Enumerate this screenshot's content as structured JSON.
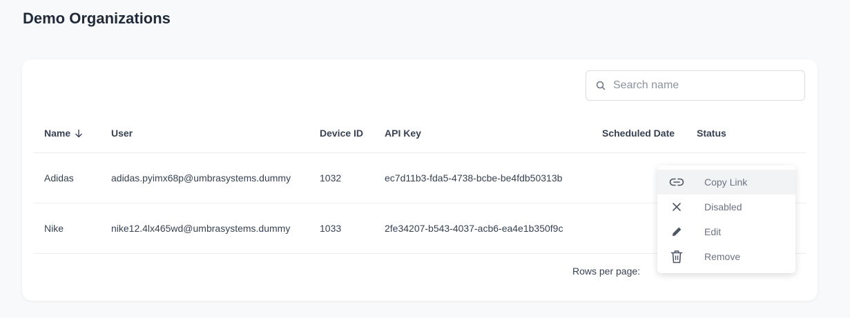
{
  "page": {
    "title": "Demo Organizations"
  },
  "search": {
    "placeholder": "Search name",
    "value": ""
  },
  "table": {
    "columns": [
      {
        "key": "name",
        "label": "Name",
        "sorted": "descending"
      },
      {
        "key": "user",
        "label": "User"
      },
      {
        "key": "device_id",
        "label": "Device ID"
      },
      {
        "key": "api_key",
        "label": "API Key"
      },
      {
        "key": "scheduled_date",
        "label": "Scheduled Date"
      },
      {
        "key": "status",
        "label": "Status"
      }
    ],
    "rows": [
      {
        "name": "Adidas",
        "user": "adidas.pyimx68p@umbrasystems.dummy",
        "device_id": "1032",
        "api_key": "ec7d11b3-fda5-4738-bcbe-be4fdb50313b",
        "scheduled_date": "",
        "status": ""
      },
      {
        "name": "Nike",
        "user": "nike12.4lx465wd@umbrasystems.dummy",
        "device_id": "1033",
        "api_key": "2fe34207-b543-4037-acb6-ea4e1b350f9c",
        "scheduled_date": "",
        "status": ""
      }
    ]
  },
  "pagination": {
    "rows_per_page_label": "Rows per page:"
  },
  "context_menu": {
    "items": [
      {
        "label": "Copy Link",
        "icon": "link-icon",
        "active": true
      },
      {
        "label": "Disabled",
        "icon": "close-icon",
        "active": false
      },
      {
        "label": "Edit",
        "icon": "pencil-icon",
        "active": false
      },
      {
        "label": "Remove",
        "icon": "trash-icon",
        "active": false
      }
    ]
  },
  "colors": {
    "background": "#f8f9fa",
    "card": "#ffffff",
    "text": "#1f2937",
    "muted": "#6b7280",
    "border": "#d9dce1"
  }
}
